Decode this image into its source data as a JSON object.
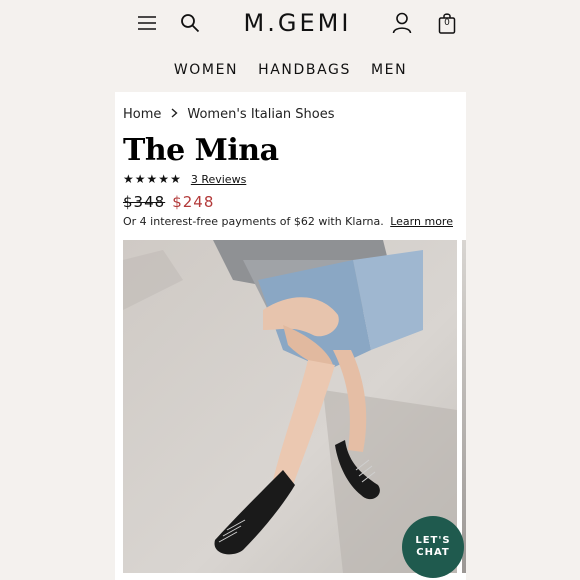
{
  "header": {
    "logo": "M.GEMI",
    "cart_count": "0",
    "icons": [
      "menu-icon",
      "search-icon",
      "account-icon",
      "cart-icon"
    ]
  },
  "nav": {
    "items": [
      {
        "label": "WOMEN"
      },
      {
        "label": "HANDBAGS"
      },
      {
        "label": "MEN"
      }
    ]
  },
  "breadcrumb": {
    "home": "Home",
    "current": "Women's Italian Shoes",
    "separator_icon": "chevron-right-icon"
  },
  "product": {
    "title": "The Mina",
    "rating": 5,
    "stars": [
      "★",
      "★",
      "★",
      "★",
      "★"
    ],
    "reviews_label": "3 Reviews",
    "price_original": "$348",
    "price_sale": "$248",
    "klarna_text": "Or 4 interest-free payments of $62 with Klarna.",
    "klarna_link": "Learn more"
  },
  "chat": {
    "line1": "LET'S",
    "line2": "CHAT"
  },
  "colors": {
    "header_bg": "#f4f1ee",
    "sale_price": "#b33a3a",
    "chat_button": "#1f5a4e"
  }
}
